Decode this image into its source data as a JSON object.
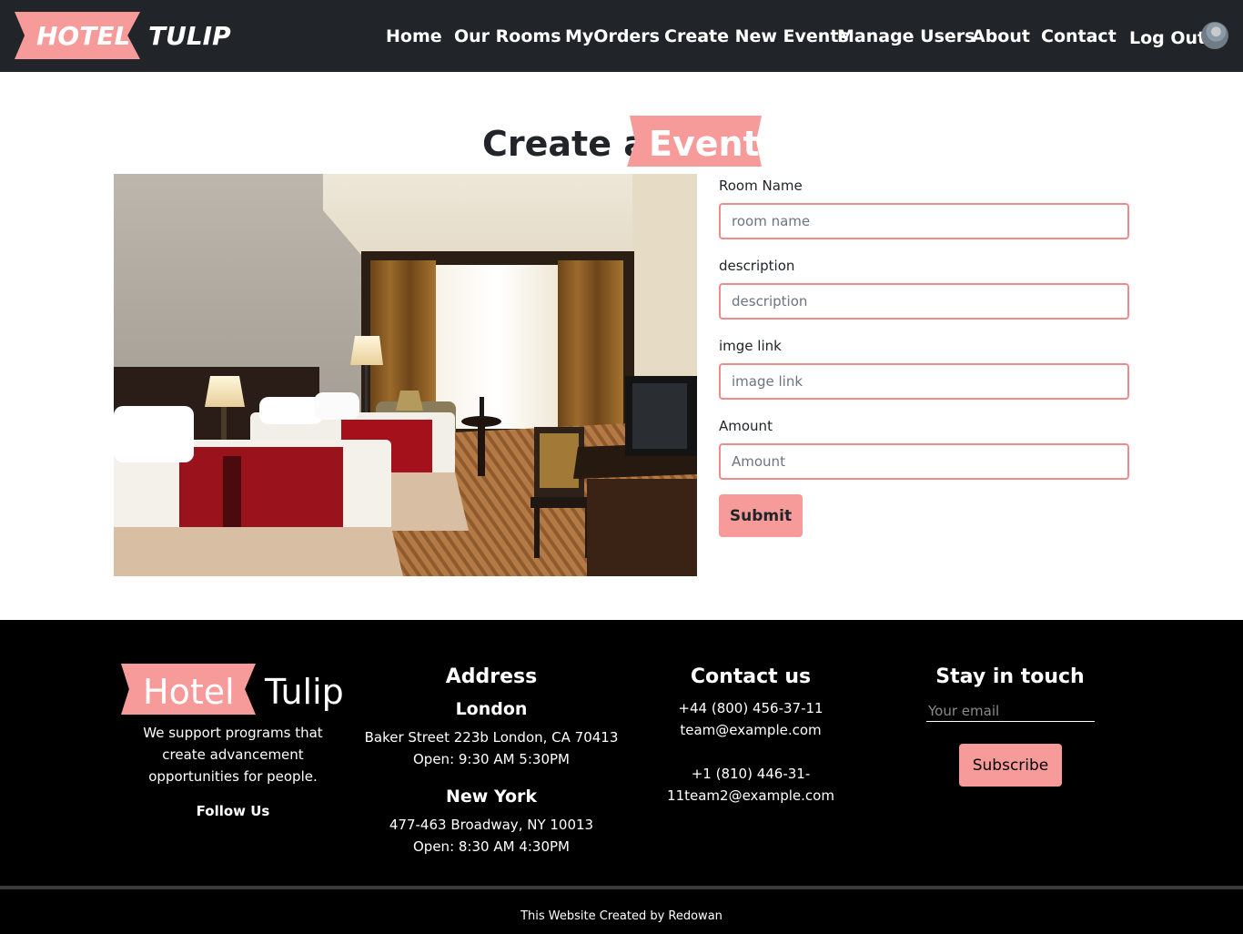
{
  "brand": {
    "word1": "HOTEL",
    "word2": "TULIP"
  },
  "nav": {
    "items": [
      "Home",
      "Our Rooms",
      "MyOrders",
      "Create New Events",
      "Manage Users",
      "About",
      "Contact"
    ],
    "logout": "Log Out"
  },
  "heading": {
    "prefix": "Create a",
    "highlight": "Event"
  },
  "form": {
    "fields": [
      {
        "label": "Room Name",
        "placeholder": "room name"
      },
      {
        "label": "description",
        "placeholder": "description"
      },
      {
        "label": "imge link",
        "placeholder": "image link"
      },
      {
        "label": "Amount",
        "placeholder": "Amount"
      }
    ],
    "submit": "Submit"
  },
  "footer": {
    "brand": {
      "word1": "Hotel",
      "word2": "Tulip"
    },
    "tagline": "We support programs that create advancement opportunities for people.",
    "follow": "Follow Us",
    "address": {
      "title": "Address",
      "city1": "London",
      "city1_street": "Baker Street 223b London, CA 70413",
      "city1_hours": "Open: 9:30 AM 5:30PM",
      "city2": "New York",
      "city2_street": "477-463 Broadway, NY 10013",
      "city2_hours": "Open: 8:30 AM 4:30PM"
    },
    "contact": {
      "title": "Contact us",
      "phone1": "+44 (800) 456-37-11",
      "email1": "team@example.com",
      "phone2": "+1 (810) 446-31-",
      "email2": "11team2@example.com"
    },
    "stay": {
      "title": "Stay in touch",
      "email_placeholder": "Your email",
      "subscribe": "Subscribe"
    },
    "credit": "This Website Created by Redowan"
  },
  "colors": {
    "accent": "#f69a9a",
    "navbar": "#212529",
    "footer": "#000000",
    "input_border": "#f08b8b"
  },
  "icons": {
    "avatar": "user-avatar"
  }
}
